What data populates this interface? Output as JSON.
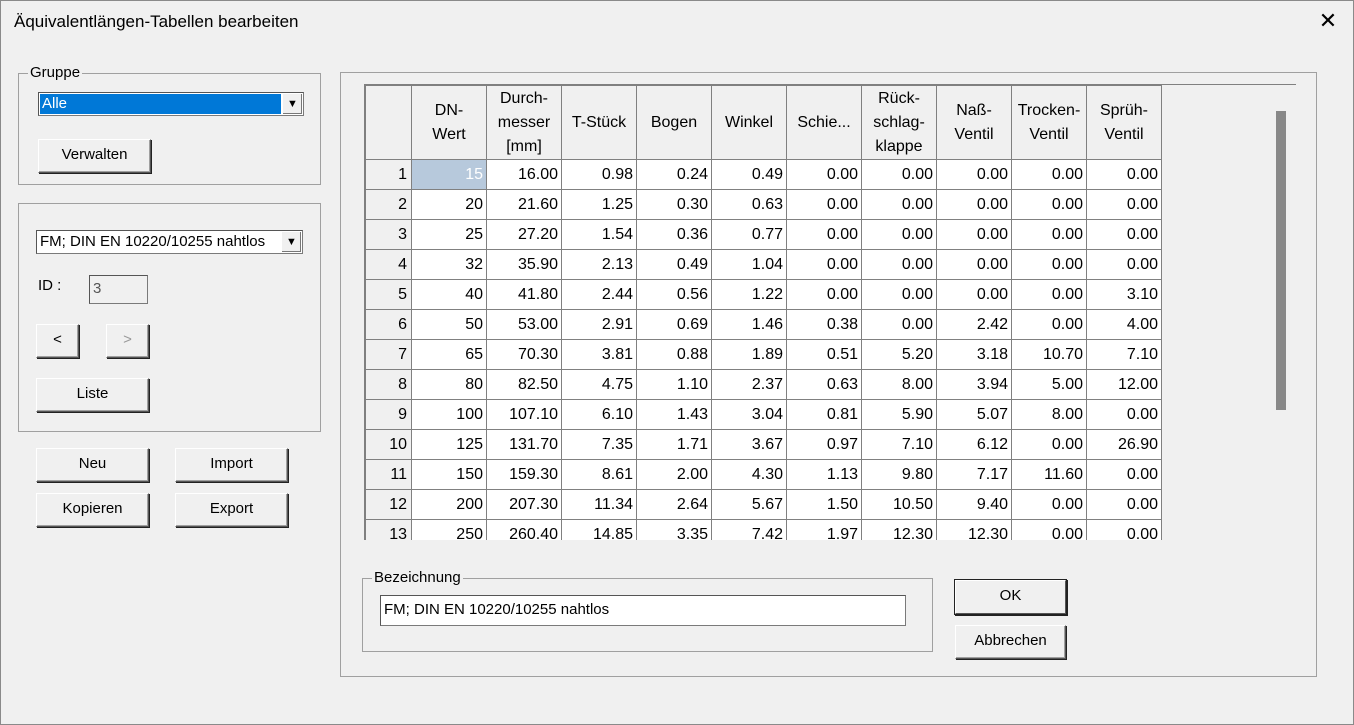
{
  "window": {
    "title": "Äquivalentlängen-Tabellen bearbeiten",
    "close_glyph": "✕"
  },
  "group": {
    "label": "Gruppe",
    "selected": "Alle",
    "manage_button": "Verwalten"
  },
  "table_select": {
    "selected": "FM; DIN EN 10220/10255 nahtlos",
    "id_label": "ID :",
    "id_value": "3",
    "prev_button": "<",
    "next_button": ">",
    "list_button": "Liste"
  },
  "actions": {
    "new": "Neu",
    "import": "Import",
    "copy": "Kopieren",
    "export": "Export"
  },
  "grid": {
    "columns": [
      [
        "DN-",
        "Wert"
      ],
      [
        "Durch-",
        "messer",
        "[mm]"
      ],
      [
        "T-Stück"
      ],
      [
        "Bogen"
      ],
      [
        "Winkel"
      ],
      [
        "Schie..."
      ],
      [
        "Rück-",
        "schlag-",
        "klappe"
      ],
      [
        "Naß-",
        "Ventil"
      ],
      [
        "Trocken-",
        "Ventil"
      ],
      [
        "Sprüh-",
        "Ventil"
      ]
    ],
    "rows": [
      {
        "n": "1",
        "v": [
          "15",
          "16.00",
          "0.98",
          "0.24",
          "0.49",
          "0.00",
          "0.00",
          "0.00",
          "0.00",
          "0.00"
        ]
      },
      {
        "n": "2",
        "v": [
          "20",
          "21.60",
          "1.25",
          "0.30",
          "0.63",
          "0.00",
          "0.00",
          "0.00",
          "0.00",
          "0.00"
        ]
      },
      {
        "n": "3",
        "v": [
          "25",
          "27.20",
          "1.54",
          "0.36",
          "0.77",
          "0.00",
          "0.00",
          "0.00",
          "0.00",
          "0.00"
        ]
      },
      {
        "n": "4",
        "v": [
          "32",
          "35.90",
          "2.13",
          "0.49",
          "1.04",
          "0.00",
          "0.00",
          "0.00",
          "0.00",
          "0.00"
        ]
      },
      {
        "n": "5",
        "v": [
          "40",
          "41.80",
          "2.44",
          "0.56",
          "1.22",
          "0.00",
          "0.00",
          "0.00",
          "0.00",
          "3.10"
        ]
      },
      {
        "n": "6",
        "v": [
          "50",
          "53.00",
          "2.91",
          "0.69",
          "1.46",
          "0.38",
          "0.00",
          "2.42",
          "0.00",
          "4.00"
        ]
      },
      {
        "n": "7",
        "v": [
          "65",
          "70.30",
          "3.81",
          "0.88",
          "1.89",
          "0.51",
          "5.20",
          "3.18",
          "10.70",
          "7.10"
        ]
      },
      {
        "n": "8",
        "v": [
          "80",
          "82.50",
          "4.75",
          "1.10",
          "2.37",
          "0.63",
          "8.00",
          "3.94",
          "5.00",
          "12.00"
        ]
      },
      {
        "n": "9",
        "v": [
          "100",
          "107.10",
          "6.10",
          "1.43",
          "3.04",
          "0.81",
          "5.90",
          "5.07",
          "8.00",
          "0.00"
        ]
      },
      {
        "n": "10",
        "v": [
          "125",
          "131.70",
          "7.35",
          "1.71",
          "3.67",
          "0.97",
          "7.10",
          "6.12",
          "0.00",
          "26.90"
        ]
      },
      {
        "n": "11",
        "v": [
          "150",
          "159.30",
          "8.61",
          "2.00",
          "4.30",
          "1.13",
          "9.80",
          "7.17",
          "11.60",
          "0.00"
        ]
      },
      {
        "n": "12",
        "v": [
          "200",
          "207.30",
          "11.34",
          "2.64",
          "5.67",
          "1.50",
          "10.50",
          "9.40",
          "0.00",
          "0.00"
        ]
      },
      {
        "n": "13",
        "v": [
          "250",
          "260.40",
          "14.85",
          "3.35",
          "7.42",
          "1.97",
          "12.30",
          "12.30",
          "0.00",
          "0.00"
        ]
      }
    ]
  },
  "designation": {
    "label": "Bezeichnung",
    "value": "FM; DIN EN 10220/10255 nahtlos"
  },
  "dialog_buttons": {
    "ok": "OK",
    "cancel": "Abbrechen"
  }
}
